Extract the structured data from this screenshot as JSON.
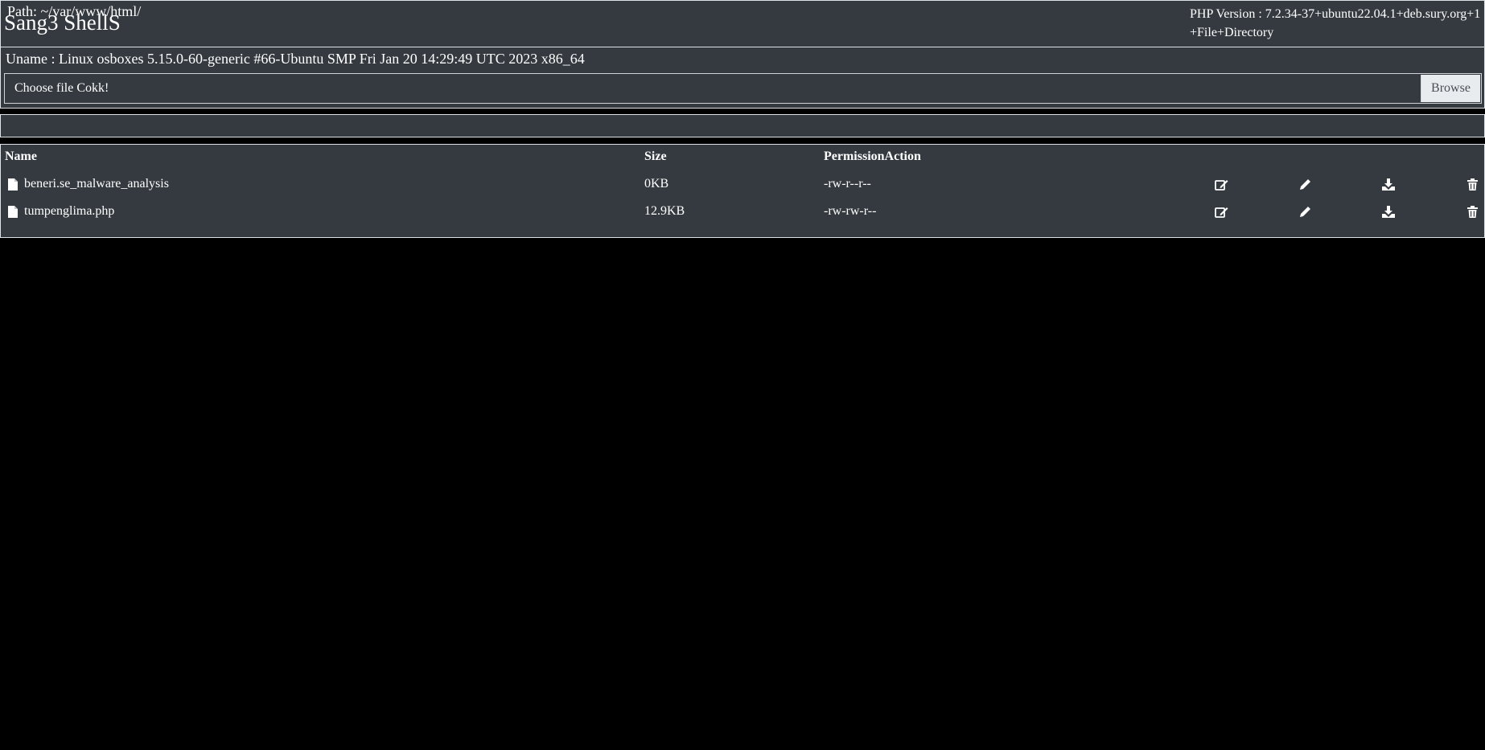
{
  "header": {
    "title": "Sang3 ShellS",
    "php_version": "PHP Version : 7.2.34-37+ubuntu22.04.1+deb.sury.org+1",
    "file_dir_link": "+File+Directory"
  },
  "system": {
    "uname": "Uname : Linux osboxes 5.15.0-60-generic #66-Ubuntu SMP Fri Jan 20 14:29:49 UTC 2023 x86_64"
  },
  "upload": {
    "label": "Choose file Cokk!",
    "browse_label": "Browse"
  },
  "path": {
    "text": "Path: ~/var/www/html/"
  },
  "table": {
    "headers": {
      "name": "Name",
      "size": "Size",
      "permission_action": "PermissionAction"
    },
    "rows": [
      {
        "name": "beneri.se_malware_analysis",
        "size": "0KB",
        "permission": "-rw-r--r--"
      },
      {
        "name": "tumpenglima.php",
        "size": "12.9KB",
        "permission": "-rw-rw-r--"
      }
    ],
    "action_icons": [
      "edit-icon",
      "rename-icon",
      "download-icon",
      "delete-icon"
    ]
  },
  "colors": {
    "page_bg": "#000000",
    "panel_bg": "#343a40",
    "border": "#dee2e6",
    "text": "#ffffff",
    "button_bg": "#e9ecef"
  }
}
